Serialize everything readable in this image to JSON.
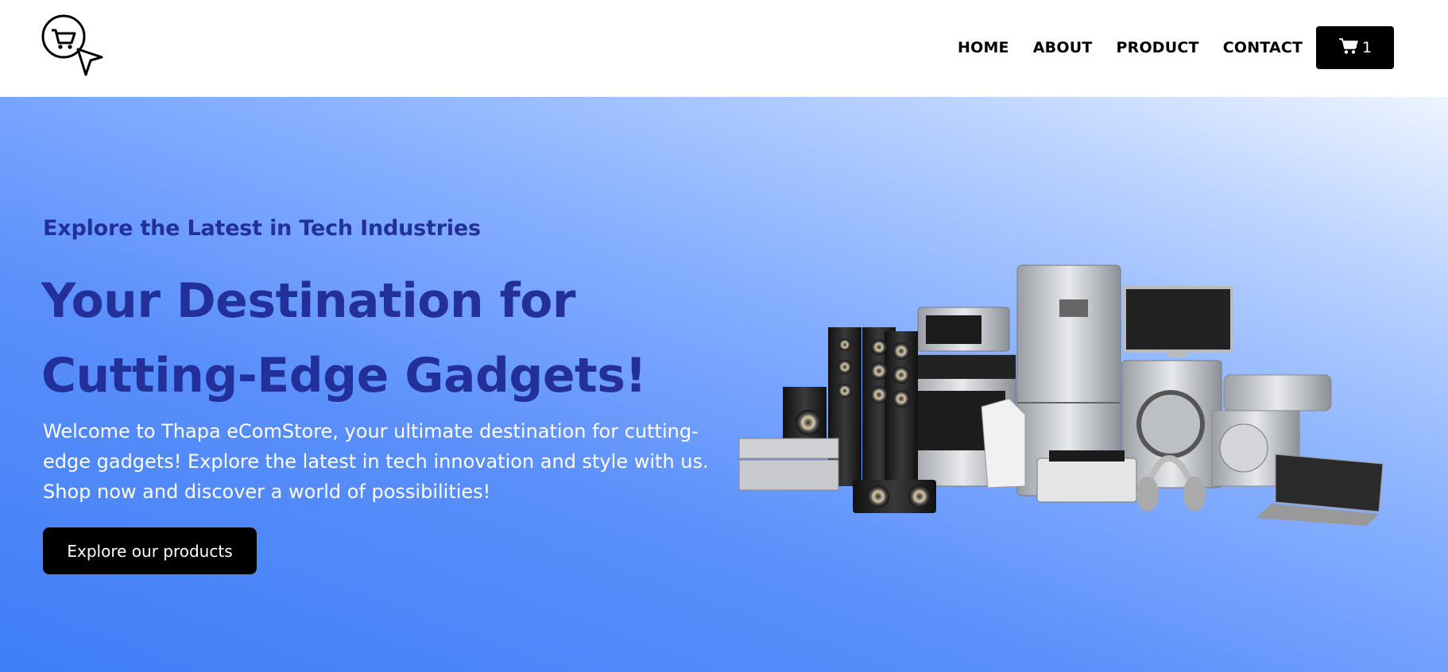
{
  "header": {
    "logo_icon": "cart-cursor-logo-icon",
    "nav": [
      {
        "label": "HOME"
      },
      {
        "label": "ABOUT"
      },
      {
        "label": "PRODUCT"
      },
      {
        "label": "CONTACT"
      }
    ],
    "cart": {
      "icon": "cart-icon",
      "count": "1"
    }
  },
  "hero": {
    "eyebrow": "Explore the Latest in Tech Industries",
    "headline_line1": "Your Destination for",
    "headline_line2": "Cutting-Edge Gadgets!",
    "description": "Welcome to Thapa eComStore, your ultimate destination for cutting-edge gadgets! Explore the latest in tech innovation and style with us. Shop now and discover a world of possibilities!",
    "cta_label": "Explore our products"
  },
  "colors": {
    "accent": "#24309a",
    "button": "#000000",
    "hero_gradient_start": "#eef4ff",
    "hero_gradient_end": "#3f7ef7"
  }
}
